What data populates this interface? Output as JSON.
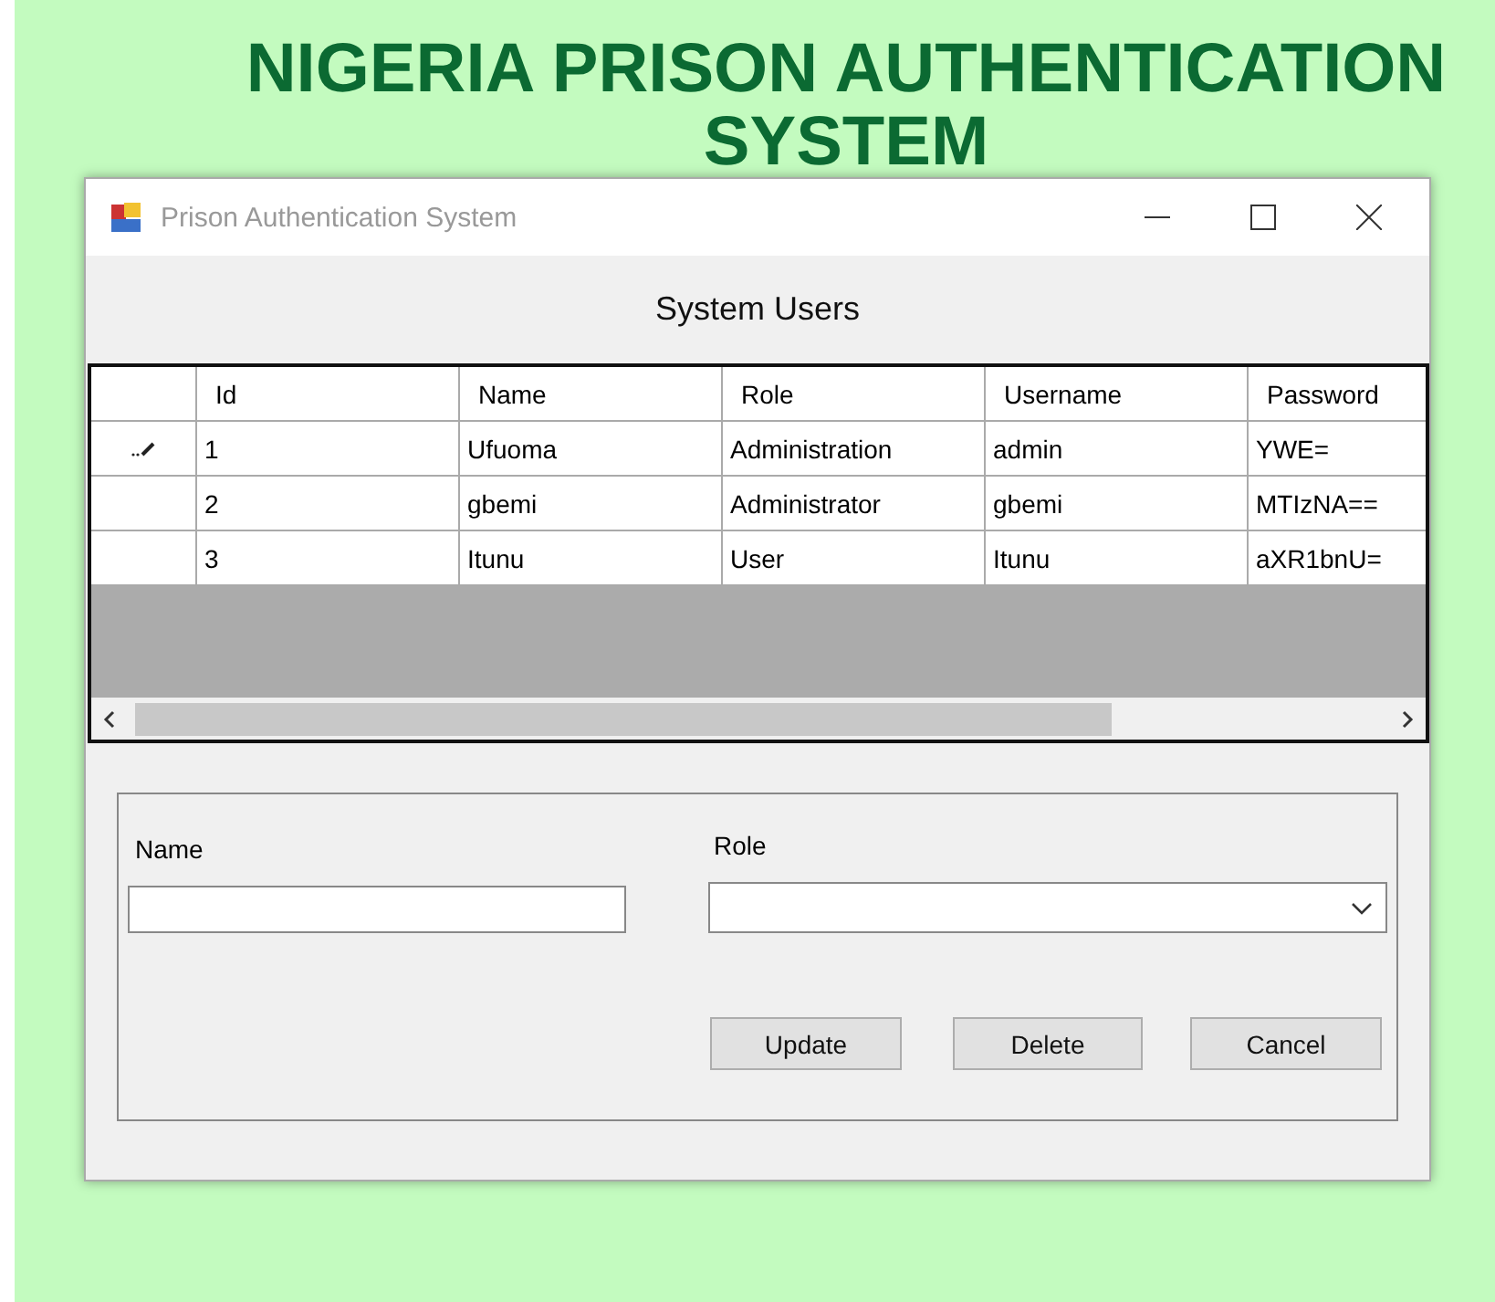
{
  "banner": {
    "title_lines": [
      "NIGERIA PRISON AUTHENTICATION",
      "SYSTEM"
    ]
  },
  "window": {
    "title": "Prison Authentication System"
  },
  "heading": "System Users",
  "table": {
    "columns": [
      "Id",
      "Name",
      "Role",
      "Username",
      "Password"
    ],
    "rows": [
      {
        "editing": true,
        "cells": [
          "1",
          "Ufuoma",
          "Administration",
          "admin",
          "YWE="
        ]
      },
      {
        "editing": false,
        "cells": [
          "2",
          "gbemi",
          "Administrator",
          "gbemi",
          "MTIzNA=="
        ]
      },
      {
        "editing": false,
        "cells": [
          "3",
          "Itunu",
          "User",
          "Itunu",
          "aXR1bnU="
        ]
      }
    ]
  },
  "form": {
    "name_label": "Name",
    "role_label": "Role",
    "buttons": [
      "Update",
      "Delete",
      "Cancel"
    ]
  }
}
